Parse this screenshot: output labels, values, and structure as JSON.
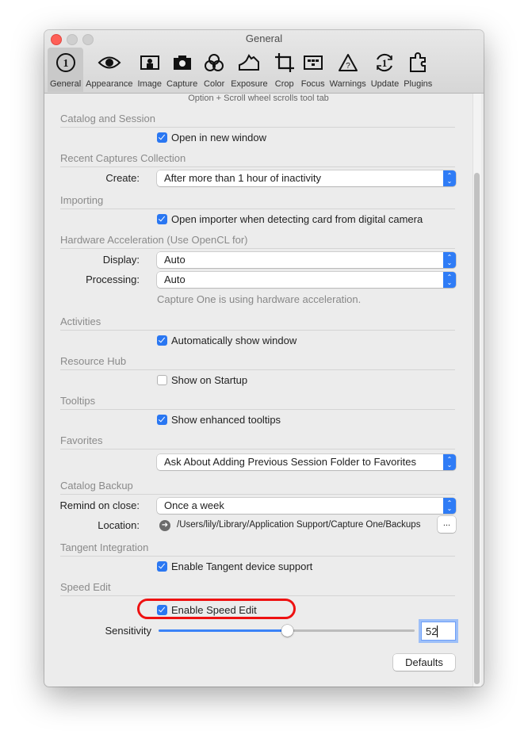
{
  "window": {
    "title": "General"
  },
  "toolbar": {
    "items": [
      {
        "label": "General",
        "icon": "general-icon",
        "active": true
      },
      {
        "label": "Appearance",
        "icon": "eye-icon"
      },
      {
        "label": "Image",
        "icon": "image-icon"
      },
      {
        "label": "Capture",
        "icon": "camera-icon"
      },
      {
        "label": "Color",
        "icon": "color-circles-icon"
      },
      {
        "label": "Exposure",
        "icon": "histogram-icon"
      },
      {
        "label": "Crop",
        "icon": "crop-icon"
      },
      {
        "label": "Focus",
        "icon": "focus-icon"
      },
      {
        "label": "Warnings",
        "icon": "warning-icon"
      },
      {
        "label": "Update",
        "icon": "update-icon"
      },
      {
        "label": "Plugins",
        "icon": "puzzle-icon"
      }
    ]
  },
  "hint": "Option + Scroll wheel scrolls tool tab",
  "sections": {
    "catalog_session": {
      "title": "Catalog and Session",
      "open_new_window": {
        "label": "Open in new window",
        "checked": true
      }
    },
    "recent_captures": {
      "title": "Recent Captures Collection",
      "create_label": "Create:",
      "create_value": "After more than 1 hour of inactivity"
    },
    "importing": {
      "title": "Importing",
      "open_importer": {
        "label": "Open importer when detecting card from digital camera",
        "checked": true
      }
    },
    "hardware": {
      "title": "Hardware Acceleration (Use OpenCL for)",
      "display_label": "Display:",
      "display_value": "Auto",
      "processing_label": "Processing:",
      "processing_value": "Auto",
      "note": "Capture One is using hardware acceleration."
    },
    "activities": {
      "title": "Activities",
      "auto_show": {
        "label": "Automatically show window",
        "checked": true
      }
    },
    "resource_hub": {
      "title": "Resource Hub",
      "show_startup": {
        "label": "Show on Startup",
        "checked": false
      }
    },
    "tooltips": {
      "title": "Tooltips",
      "enhanced": {
        "label": "Show enhanced tooltips",
        "checked": true
      }
    },
    "favorites": {
      "title": "Favorites",
      "value": "Ask About Adding Previous Session Folder to Favorites"
    },
    "catalog_backup": {
      "title": "Catalog Backup",
      "remind_label": "Remind on close:",
      "remind_value": "Once a week",
      "location_label": "Location:",
      "location_path": "/Users/lily/Library/Application Support/Capture One/Backups",
      "browse_label": "..."
    },
    "tangent": {
      "title": "Tangent Integration",
      "enable": {
        "label": "Enable Tangent device support",
        "checked": true
      }
    },
    "speed_edit": {
      "title": "Speed Edit",
      "enable": {
        "label": "Enable Speed Edit",
        "checked": true
      },
      "sensitivity_label": "Sensitivity",
      "sensitivity_value": "52",
      "sensitivity_fraction": 0.5
    }
  },
  "defaults_label": "Defaults",
  "colors": {
    "accent": "#2a77f2",
    "highlight": "#ee1111"
  }
}
